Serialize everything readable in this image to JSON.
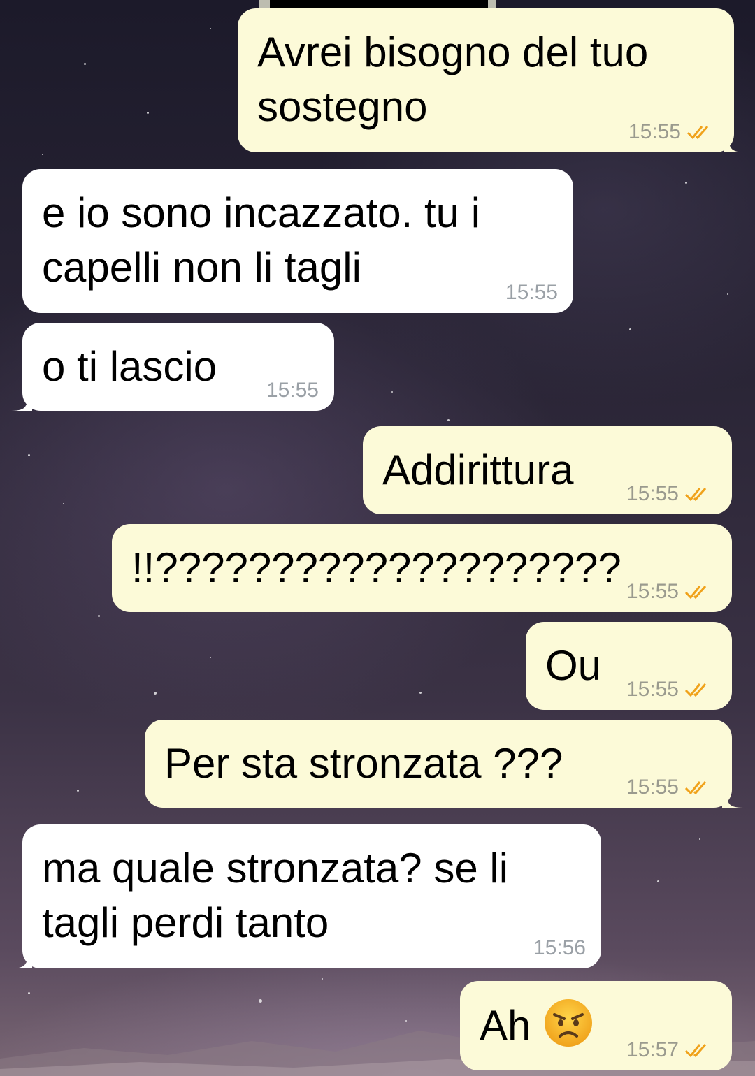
{
  "colors": {
    "outgoing_bubble": "#fcfad8",
    "incoming_bubble": "#ffffff",
    "read_ticks": "#f0a21b",
    "timestamp": "#9a9a8e"
  },
  "messages": [
    {
      "direction": "out",
      "text": "Avrei bisogno del tuo\nsostegno",
      "time": "15:55",
      "status_icon": "double-check-icon"
    },
    {
      "direction": "in",
      "text": "e io sono incazzato. tu i\ncapelli non li tagli",
      "time": "15:55"
    },
    {
      "direction": "in",
      "text": "o ti lascio",
      "time": "15:55"
    },
    {
      "direction": "out",
      "text": "Addirittura",
      "time": "15:55",
      "status_icon": "double-check-icon"
    },
    {
      "direction": "out",
      "text": "!!????????????????????",
      "time": "15:55",
      "status_icon": "double-check-icon"
    },
    {
      "direction": "out",
      "text": "Ou",
      "time": "15:55",
      "status_icon": "double-check-icon"
    },
    {
      "direction": "out",
      "text": "Per sta stronzata ???",
      "time": "15:55",
      "status_icon": "double-check-icon"
    },
    {
      "direction": "in",
      "text": "ma quale stronzata? se li\ntagli perdi tanto",
      "time": "15:56"
    },
    {
      "direction": "out",
      "text": "Ah",
      "emoji": "angry-face",
      "time": "15:57",
      "status_icon": "double-check-icon"
    }
  ]
}
